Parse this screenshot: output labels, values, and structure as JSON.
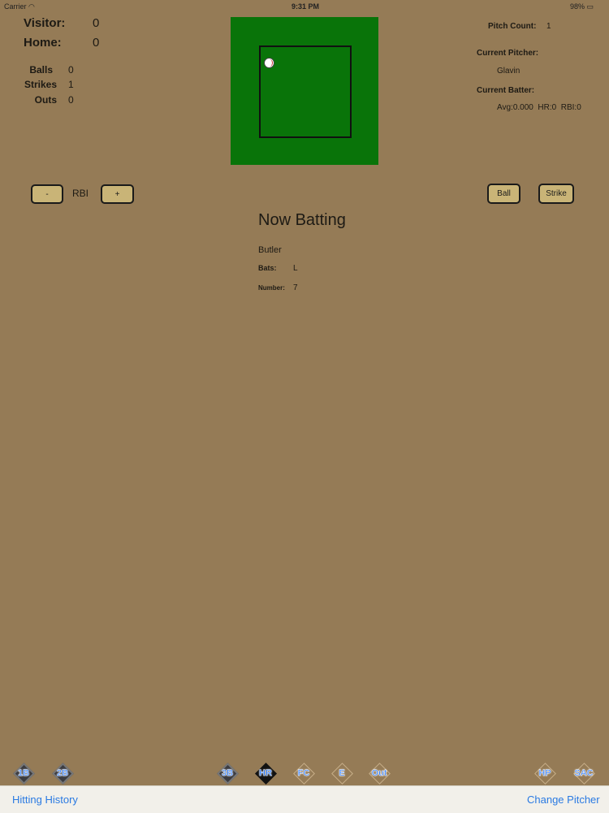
{
  "status_bar": {
    "carrier": "Carrier",
    "time": "9:31 PM",
    "battery": "98%"
  },
  "scoreboard": {
    "visitor_label": "Visitor:",
    "visitor_score": "0",
    "home_label": "Home:",
    "home_score": "0"
  },
  "count": {
    "balls_label": "Balls",
    "balls": "0",
    "strikes_label": "Strikes",
    "strikes": "1",
    "outs_label": "Outs",
    "outs": "0"
  },
  "strike_zone": {
    "zone_color": "#097409",
    "pitch_icon": "baseball-icon"
  },
  "pitch_info": {
    "pitch_count_label": "Pitch Count:",
    "pitch_count": "1",
    "current_pitcher_label": "Current Pitcher:",
    "current_pitcher": "Glavin",
    "current_batter_label": "Current Batter:",
    "batter_stats": "Avg:0.000  HR:0  RBI:0"
  },
  "rbi_controls": {
    "minus_label": "-",
    "rbi_label": "RBI",
    "plus_label": "+"
  },
  "pitch_buttons": {
    "ball_label": "Ball",
    "strike_label": "Strike"
  },
  "now_batting": {
    "title": "Now Batting",
    "name": "Butler",
    "bats_label": "Bats:",
    "bats": "L",
    "number_label": "Number:",
    "number": "7"
  },
  "hit_buttons": {
    "single": "1B",
    "double": "2B",
    "triple": "3B",
    "home_run": "HR",
    "fielders_choice": "FC",
    "error": "E",
    "out": "Out",
    "hit_by_pitch": "HP",
    "sacrifice": "SAC"
  },
  "tab_bar": {
    "hitting_history": "Hitting History",
    "change_pitcher": "Change Pitcher"
  },
  "colors": {
    "background": "#957b56",
    "button": "#c9b477",
    "link": "#2a7ae2"
  }
}
